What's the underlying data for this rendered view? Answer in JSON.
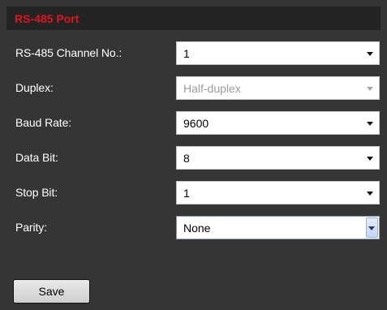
{
  "panel": {
    "title": "RS-485 Port"
  },
  "fields": [
    {
      "label": "RS-485 Channel No.:",
      "value": "1",
      "disabled": false
    },
    {
      "label": "Duplex:",
      "value": "Half-duplex",
      "disabled": true
    },
    {
      "label": "Baud Rate:",
      "value": "9600",
      "disabled": false
    },
    {
      "label": "Data Bit:",
      "value": "8",
      "disabled": false
    },
    {
      "label": "Stop Bit:",
      "value": "1",
      "disabled": false
    },
    {
      "label": "Parity:",
      "value": "None",
      "disabled": false,
      "focused": true
    }
  ],
  "actions": {
    "save_label": "Save"
  },
  "colors": {
    "panel_background": "#353535",
    "header_background": "#242424",
    "title_color": "#e0141e"
  }
}
